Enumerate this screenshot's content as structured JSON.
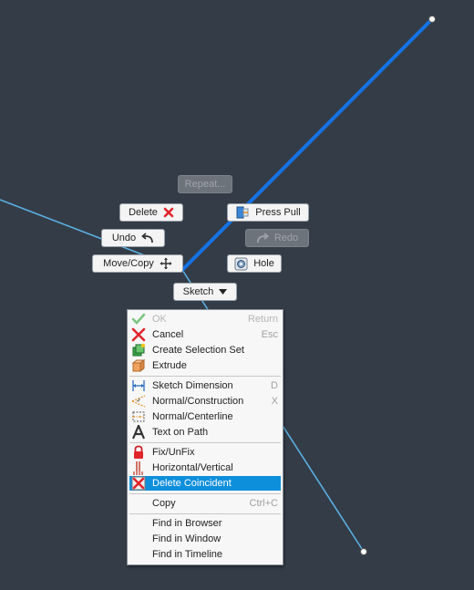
{
  "marking_menu": {
    "repeat": "Repeat...",
    "delete": "Delete",
    "press_pull": "Press Pull",
    "undo": "Undo",
    "redo": "Redo",
    "move_copy": "Move/Copy",
    "hole": "Hole",
    "sketch": "Sketch"
  },
  "context_menu": {
    "items": [
      {
        "label": "OK",
        "shortcut": "Return",
        "icon": "check-icon",
        "disabled": true
      },
      {
        "label": "Cancel",
        "shortcut": "Esc",
        "icon": "red-x-icon"
      },
      {
        "label": "Create Selection Set",
        "shortcut": "",
        "icon": "selection-set-icon"
      },
      {
        "label": "Extrude",
        "shortcut": "",
        "icon": "extrude-icon"
      },
      {
        "label": "Sketch Dimension",
        "shortcut": "D",
        "icon": "dimension-icon"
      },
      {
        "label": "Normal/Construction",
        "shortcut": "X",
        "icon": "construction-icon"
      },
      {
        "label": "Normal/Centerline",
        "shortcut": "",
        "icon": "centerline-icon"
      },
      {
        "label": "Text on Path",
        "shortcut": "",
        "icon": "text-on-path-icon"
      },
      {
        "label": "Fix/UnFix",
        "shortcut": "",
        "icon": "lock-icon"
      },
      {
        "label": "Horizontal/Vertical",
        "shortcut": "",
        "icon": "horizontal-vertical-icon"
      },
      {
        "label": "Delete Coincident",
        "shortcut": "",
        "icon": "delete-coincident-icon",
        "highlighted": true
      },
      {
        "label": "Copy",
        "shortcut": "Ctrl+C",
        "icon": "none"
      },
      {
        "label": "Find in Browser",
        "shortcut": "",
        "icon": "none"
      },
      {
        "label": "Find in Window",
        "shortcut": "",
        "icon": "none"
      },
      {
        "label": "Find in Timeline",
        "shortcut": "",
        "icon": "none"
      }
    ]
  },
  "colors": {
    "background": "#343c47",
    "selected_line": "#1473e6",
    "sketch_line": "#5aaee0",
    "highlight": "#0e8fdb"
  }
}
